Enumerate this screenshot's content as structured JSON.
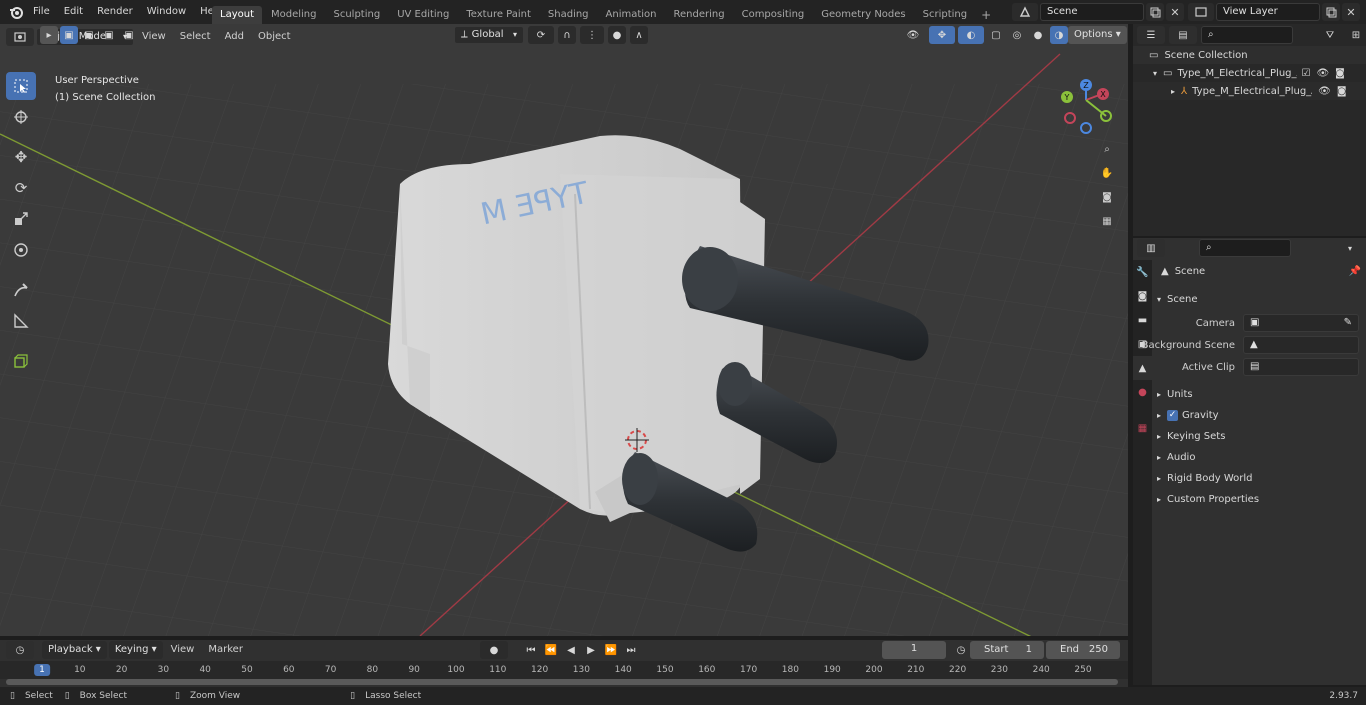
{
  "menu": [
    "File",
    "Edit",
    "Render",
    "Window",
    "Help"
  ],
  "workspaces": [
    "Layout",
    "Modeling",
    "Sculpting",
    "UV Editing",
    "Texture Paint",
    "Shading",
    "Animation",
    "Rendering",
    "Compositing",
    "Geometry Nodes",
    "Scripting"
  ],
  "active_workspace": "Layout",
  "scene_name": "Scene",
  "view_layer": "View Layer",
  "viewport": {
    "mode": "Object Mode",
    "menus": [
      "View",
      "Select",
      "Add",
      "Object"
    ],
    "orientation": "Global",
    "options_label": "Options",
    "perspective": "User Perspective",
    "collection": "(1) Scene Collection",
    "gizmo_axes": {
      "x": "X",
      "y": "Y",
      "z": "Z"
    },
    "model_label": "TYPE M"
  },
  "outliner": {
    "root": "Scene Collection",
    "items": [
      "Type_M_Electrical_Plug_Adap",
      "Type_M_Electrical_Plug_A"
    ]
  },
  "properties": {
    "context": "Scene",
    "panel": "Scene",
    "fields": [
      {
        "label": "Camera",
        "value": ""
      },
      {
        "label": "Background Scene",
        "value": ""
      },
      {
        "label": "Active Clip",
        "value": ""
      }
    ],
    "subpanels": [
      "Units",
      "Gravity",
      "Keying Sets",
      "Audio",
      "Rigid Body World",
      "Custom Properties"
    ]
  },
  "timeline": {
    "menus": [
      "Playback",
      "Keying",
      "View",
      "Marker"
    ],
    "current_frame": "1",
    "start_label": "Start",
    "start": "1",
    "end_label": "End",
    "end": "250",
    "ruler": [
      "1",
      "10",
      "20",
      "30",
      "40",
      "50",
      "60",
      "70",
      "80",
      "90",
      "100",
      "110",
      "120",
      "130",
      "140",
      "150",
      "160",
      "170",
      "180",
      "190",
      "200",
      "210",
      "220",
      "230",
      "240",
      "250"
    ]
  },
  "statusbar": {
    "hints": [
      "Select",
      "Box Select",
      "Zoom View",
      "Lasso Select"
    ],
    "version": "2.93.7"
  },
  "colors": {
    "accent": "#4772b3",
    "x_axis": "#c4455a",
    "y_axis": "#8bc13b",
    "z_axis": "#4c88e0"
  }
}
